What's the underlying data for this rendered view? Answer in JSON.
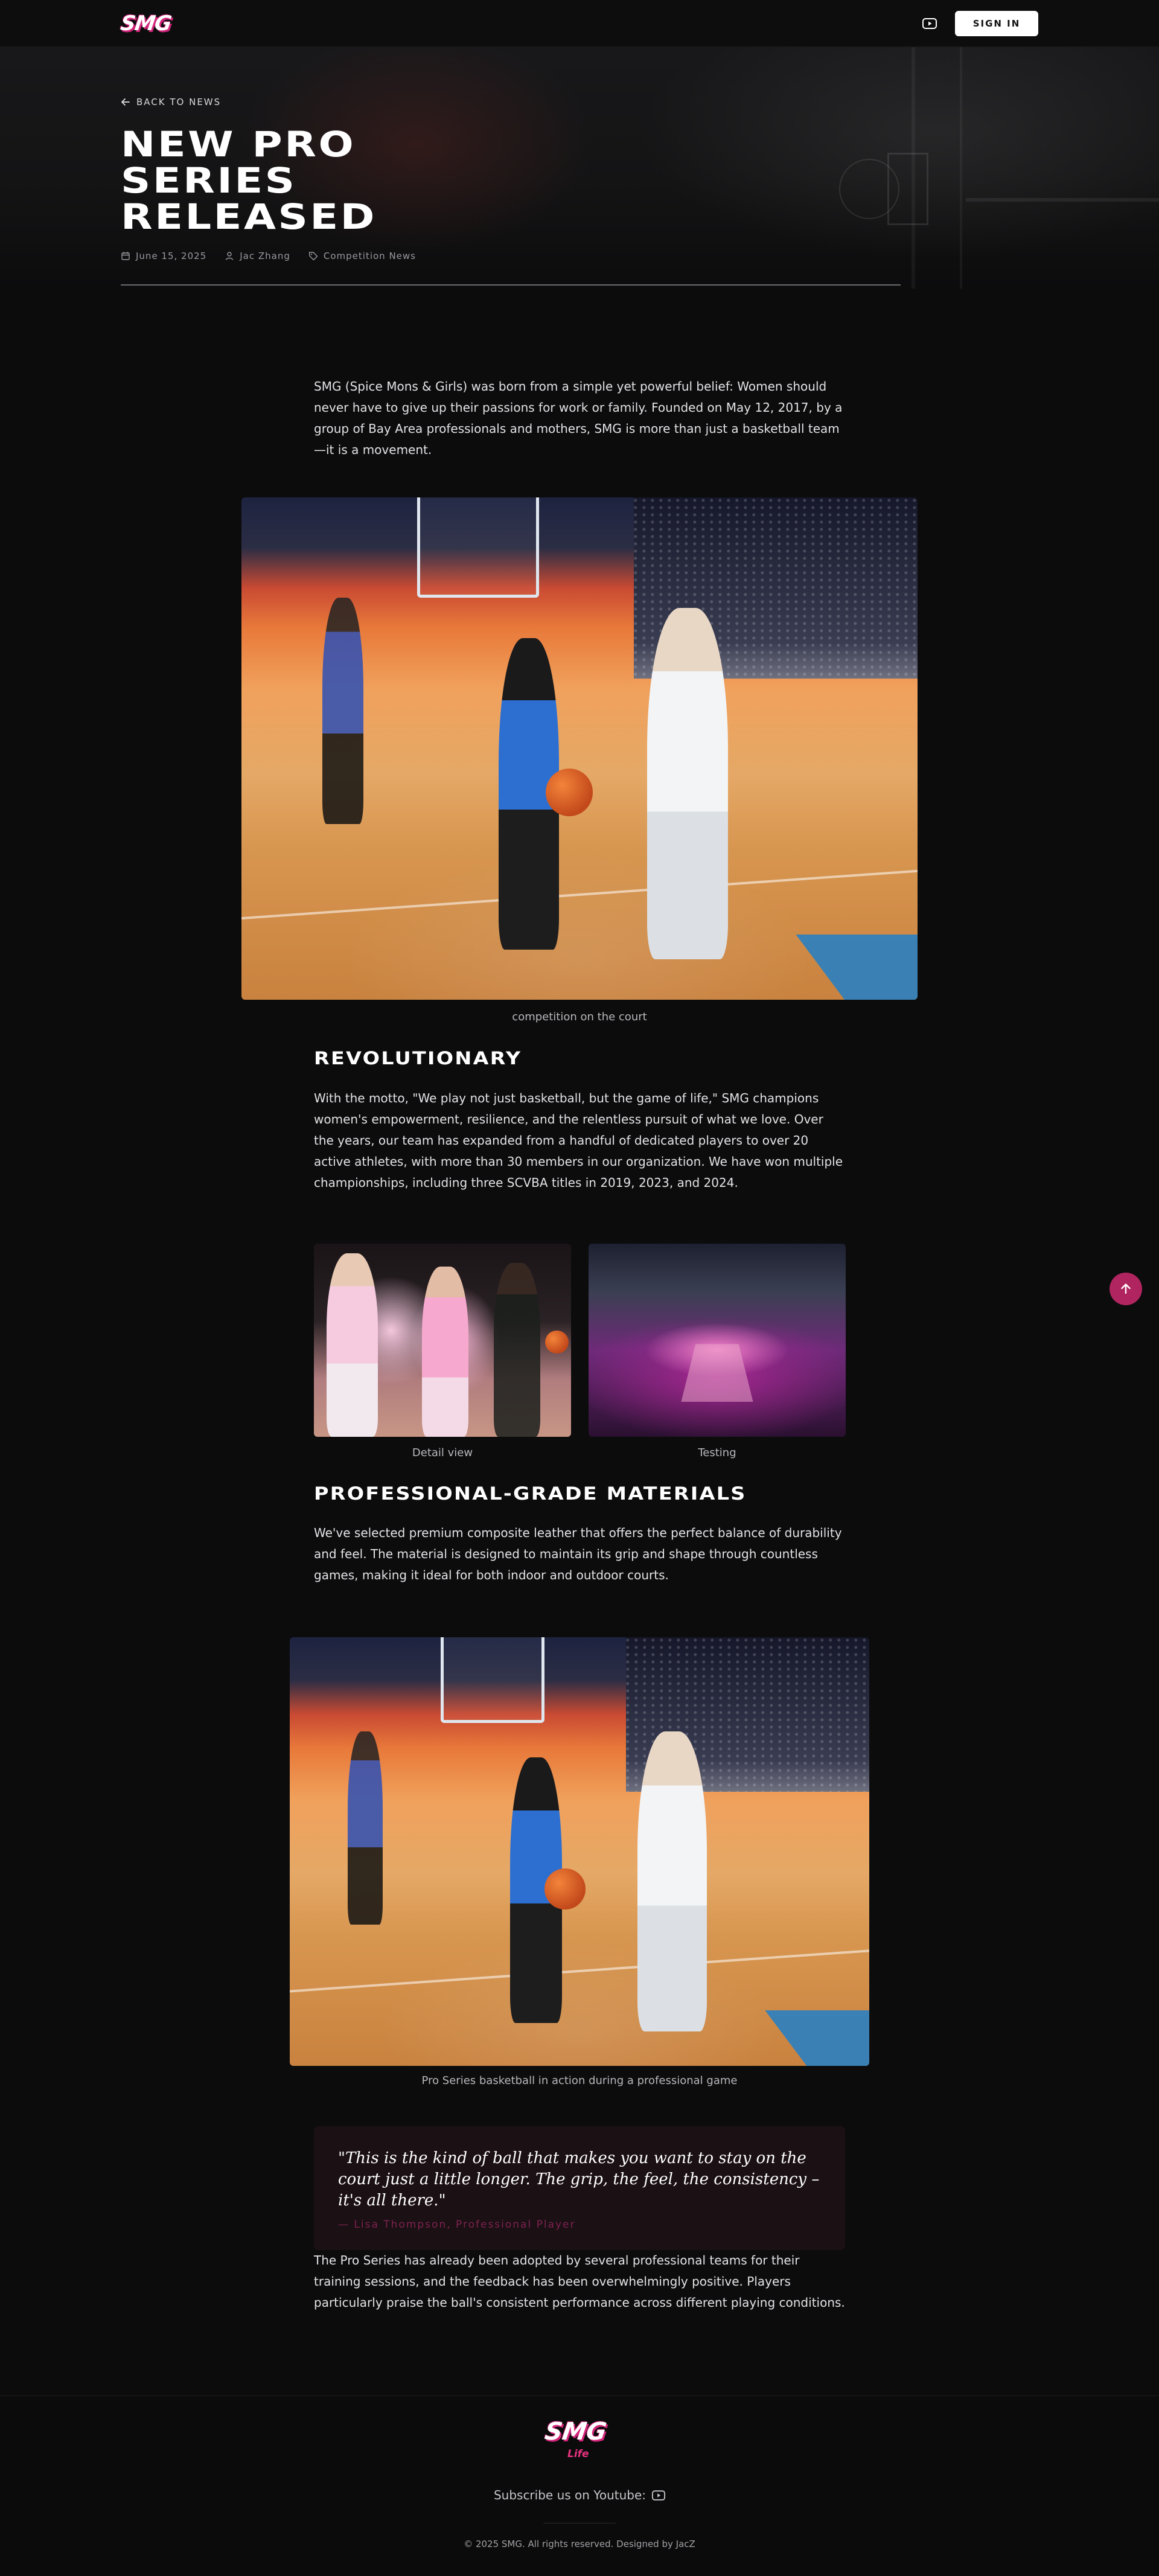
{
  "nav": {
    "logo": "SMG",
    "youtube_icon": "youtube-icon",
    "signin_label": "SIGN IN"
  },
  "hero": {
    "back_label": "BACK TO NEWS",
    "title": "NEW PRO SERIES RELEASED",
    "date": "June 15, 2025",
    "author": "Jac Zhang",
    "category": "Competition News"
  },
  "article": {
    "intro": "SMG (Spice Mons & Girls) was born from a simple yet powerful belief: Women should never have to give up their passions for work or family. Founded on May 12, 2017, by a group of Bay Area professionals and mothers, SMG is more than just a basketball team—it is a movement.",
    "image1_caption": "competition on the court",
    "section1_title": "REVOLUTIONARY",
    "section1_body": "With the motto, \"We play not just basketball, but the game of life,\" SMG champions women's empowerment, resilience, and the relentless pursuit of what we love. Over the years, our team has expanded from a handful of dedicated players to over 20 active athletes, with more than 30 members in our organization. We have won multiple championships, including three SCVBA titles in 2019, 2023, and 2024.",
    "gallery": [
      {
        "caption": "Detail view"
      },
      {
        "caption": "Testing"
      }
    ],
    "section2_title": "PROFESSIONAL-GRADE MATERIALS",
    "section2_body": "We've selected premium composite leather that offers the perfect balance of durability and feel. The material is designed to maintain its grip and shape through countless games, making it ideal for both indoor and outdoor courts.",
    "image2_caption": "Pro Series basketball in action during a professional game",
    "quote": "\"This is the kind of ball that makes you want to stay on the court just a little longer. The grip, the feel, the consistency – it's all there.\"",
    "quote_author": "— Lisa Thompson, Professional Player",
    "closing": "The Pro Series has already been adopted by several professional teams for their training sessions, and the feedback has been overwhelmingly positive. Players particularly praise the ball's consistent performance across different playing conditions."
  },
  "footer": {
    "logo": "SMG",
    "tagline": "Life",
    "subscribe_label": "Subscribe us on Youtube:",
    "copyright": "© 2025 SMG. All rights reserved. Designed by JacZ"
  },
  "colors": {
    "accent": "#d3257a",
    "background": "#0c0c0d",
    "scroll_top": "#b0245f"
  }
}
